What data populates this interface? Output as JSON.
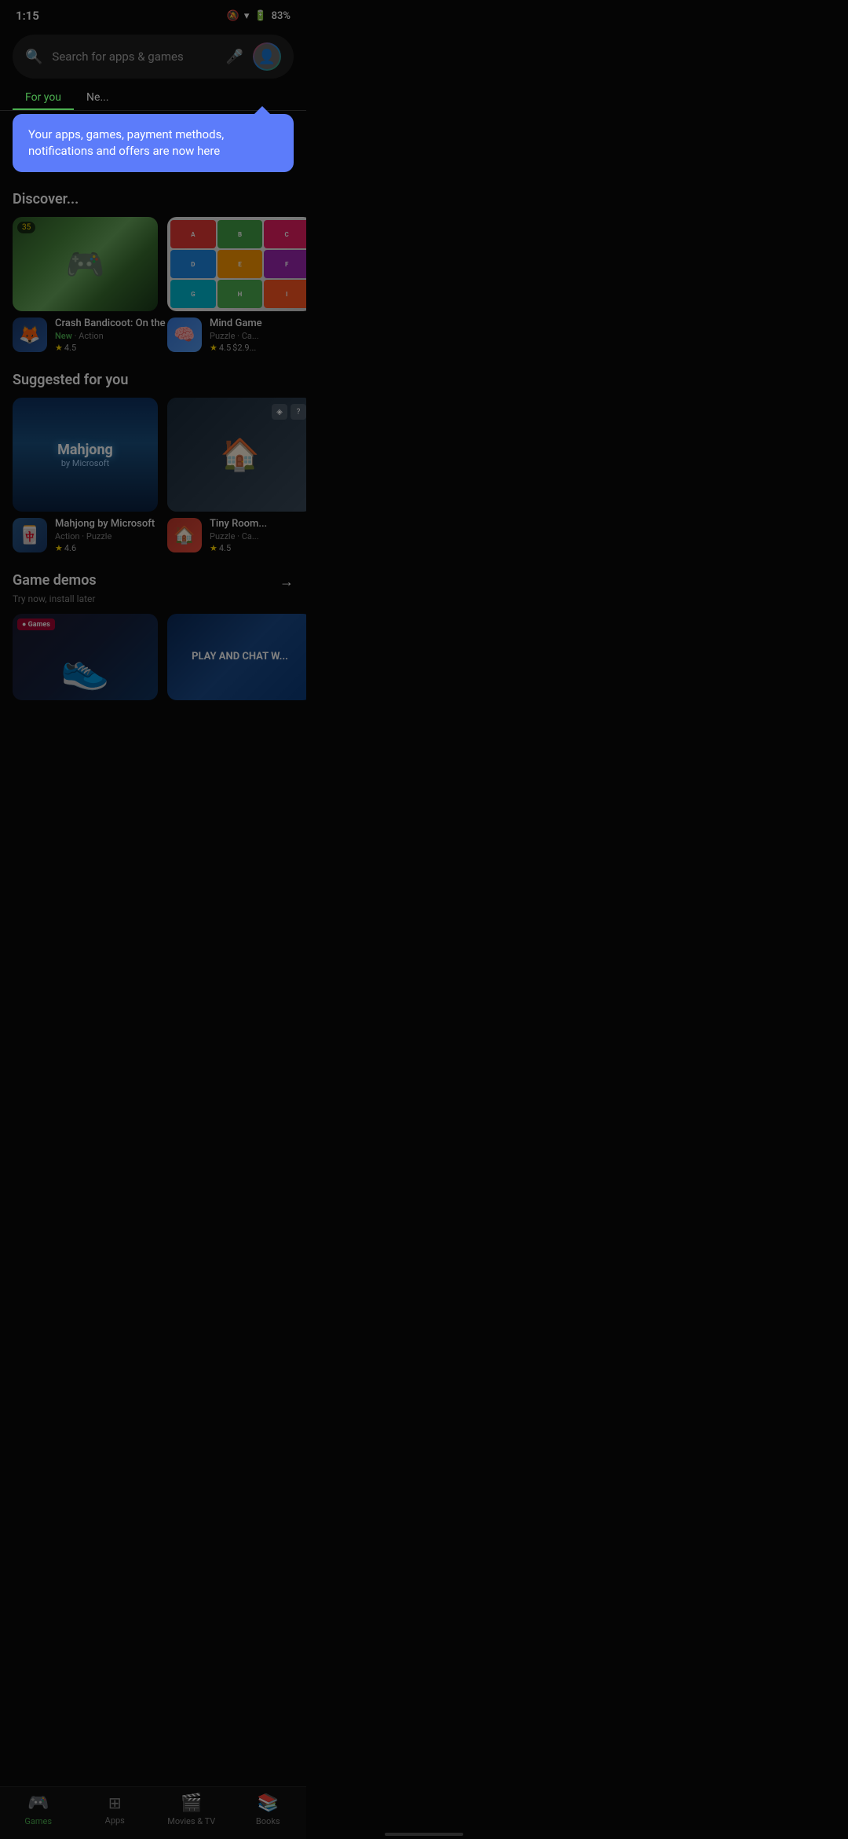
{
  "statusBar": {
    "time": "1:15",
    "batteryPercent": "83%"
  },
  "searchBar": {
    "placeholder": "Search for apps & games"
  },
  "tooltip": {
    "message": "Your apps, games, payment methods, notifications and offers are now here"
  },
  "navTabs": [
    {
      "label": "For you",
      "active": true
    },
    {
      "label": "Ne...",
      "active": false
    }
  ],
  "discoverSection": {
    "title": "Discover...",
    "apps": [
      {
        "name": "Crash Bandicoot: On the ...",
        "tag": "New",
        "category": "Action",
        "rating": "4.5",
        "badge": "35",
        "iconEmoji": "🦊"
      },
      {
        "name": "Mind Game",
        "tag": "",
        "category": "Puzzle · Ca...",
        "rating": "4.5",
        "price": "$2.9...",
        "iconEmoji": "🧠"
      }
    ]
  },
  "suggestedSection": {
    "title": "Suggested for you",
    "apps": [
      {
        "name": "Mahjong by Microsoft",
        "category": "Action · Puzzle",
        "rating": "4.6",
        "imageTitle": "Mahjong",
        "imageSub": "by Microsoft",
        "iconEmoji": "🀄"
      },
      {
        "name": "Tiny Room...",
        "category": "Puzzle · Ca...",
        "rating": "4.5",
        "iconEmoji": "🏠"
      }
    ]
  },
  "gameDemosSection": {
    "title": "Game demos",
    "subtitle": "Try now, install later",
    "arrowLabel": "→"
  },
  "bottomNav": [
    {
      "label": "Games",
      "icon": "🎮",
      "active": true
    },
    {
      "label": "Apps",
      "icon": "⊞",
      "active": false
    },
    {
      "label": "Movies & TV",
      "icon": "🎬",
      "active": false
    },
    {
      "label": "Books",
      "icon": "📚",
      "active": false
    }
  ]
}
